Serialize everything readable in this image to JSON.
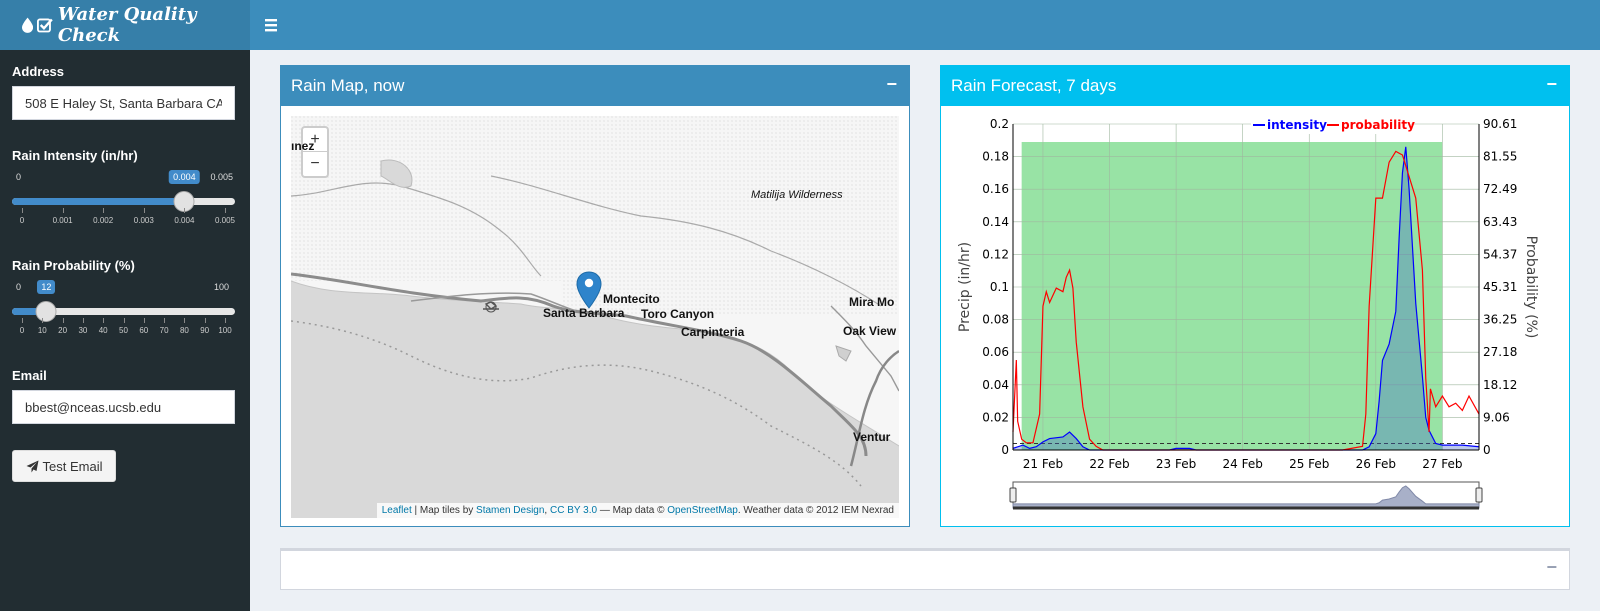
{
  "app": {
    "title": "Water Quality Check"
  },
  "sidebar": {
    "address_label": "Address",
    "address_value": "508 E Haley St, Santa Barbara CA",
    "intensity_label": "Rain Intensity (in/hr)",
    "intensity_slider": {
      "min": "0",
      "max": "0.005",
      "value": "0.004",
      "fraction": 0.8,
      "ticks": [
        "0",
        "0.001",
        "0.002",
        "0.003",
        "0.004",
        "0.005"
      ]
    },
    "probability_label": "Rain Probability (%)",
    "probability_slider": {
      "min": "0",
      "max": "100",
      "value": "12",
      "fraction": 0.12,
      "ticks": [
        "0",
        "10",
        "20",
        "30",
        "40",
        "50",
        "60",
        "70",
        "80",
        "90",
        "100"
      ]
    },
    "email_label": "Email",
    "email_value": "bbest@nceas.ucsb.edu",
    "test_button": "Test Email"
  },
  "map_box": {
    "title": "Rain Map, now",
    "collapse": "−",
    "zoom_in": "+",
    "zoom_out": "−",
    "places": {
      "ynez": "ınez",
      "matilija": "Matilija Wilderness",
      "montecito": "Montecito",
      "santa_barbara": "Santa Barbara",
      "toro_canyon": "Toro Canyon",
      "carpinteria": "Carpinteria",
      "mira_monte": "Mira Mo",
      "oak_view": "Oak View",
      "ventura": "Ventur"
    },
    "attribution": {
      "leaflet": "Leaflet",
      "sep1": " | Map tiles by ",
      "stamen": "Stamen Design",
      "sep2": ", ",
      "cc": "CC BY 3.0",
      "sep3": " — Map data © ",
      "osm": "OpenStreetMap",
      "sep4": ". Weather data © 2012 IEM Nexrad"
    }
  },
  "forecast_box": {
    "title": "Rain Forecast, 7 days",
    "collapse": "−"
  },
  "bottom_box": {
    "collapse": "−"
  },
  "colors": {
    "header": "#3c8dbc",
    "sidebar": "#222d32",
    "forecast_accent": "#00c0ef",
    "intensity": "#0000ff",
    "probability": "#ff0000"
  },
  "chart_data": {
    "type": "line",
    "ylabel": "Precip (in/hr)",
    "y2label": "Probability (%)",
    "ylim": [
      0,
      0.2
    ],
    "y2lim": [
      0,
      90.61
    ],
    "yticks": [
      "0",
      "0.02",
      "0.04",
      "0.06",
      "0.08",
      "0.1",
      "0.12",
      "0.14",
      "0.16",
      "0.18",
      "0.2"
    ],
    "y2ticks": [
      "0",
      "9.06",
      "18.12",
      "27.18",
      "36.25",
      "45.31",
      "54.37",
      "63.43",
      "72.49",
      "81.55",
      "90.61"
    ],
    "xticks": [
      "21 Feb",
      "22 Feb",
      "23 Feb",
      "24 Feb",
      "25 Feb",
      "26 Feb",
      "27 Feb"
    ],
    "xlim": [
      20.55,
      27.55
    ],
    "shaded_range": [
      20.68,
      27.0
    ],
    "threshold": 0.004,
    "legend": {
      "intensity": "intensity",
      "probability": "probability",
      "placement": "top"
    },
    "series": [
      {
        "name": "intensity",
        "x": [
          20.55,
          20.7,
          20.8,
          20.9,
          21.0,
          21.1,
          21.3,
          21.4,
          21.5,
          21.6,
          21.7,
          22.5,
          22.9,
          23.0,
          23.2,
          23.3,
          25.5,
          25.8,
          25.9,
          26.0,
          26.05,
          26.1,
          26.2,
          26.3,
          26.35,
          26.4,
          26.45,
          26.5,
          26.6,
          26.7,
          26.75,
          26.8,
          26.9,
          27.0,
          27.1,
          27.3,
          27.55
        ],
        "values": [
          0.001,
          0.003,
          0.001,
          0.002,
          0.005,
          0.007,
          0.008,
          0.011,
          0.007,
          0.002,
          0,
          0,
          0,
          0.001,
          0.001,
          0,
          0,
          0,
          0.002,
          0.01,
          0.03,
          0.055,
          0.065,
          0.085,
          0.13,
          0.17,
          0.186,
          0.16,
          0.09,
          0.045,
          0.02,
          0.012,
          0.004,
          0.003,
          0.003,
          0.003,
          0.002
        ]
      },
      {
        "name": "probability",
        "x": [
          20.55,
          20.6,
          20.62,
          20.68,
          20.75,
          20.85,
          20.95,
          21.0,
          21.05,
          21.1,
          21.2,
          21.3,
          21.35,
          21.4,
          21.45,
          21.5,
          21.6,
          21.7,
          21.8,
          21.9,
          23.0,
          25.5,
          25.8,
          25.85,
          25.9,
          26.0,
          26.1,
          26.2,
          26.3,
          26.4,
          26.5,
          26.6,
          26.7,
          26.75,
          26.8,
          26.82,
          26.9,
          27.0,
          27.1,
          27.2,
          27.3,
          27.4,
          27.55
        ],
        "values": [
          5,
          25,
          8,
          3,
          2,
          2,
          10,
          40,
          44,
          41,
          45,
          44,
          48,
          50,
          45,
          30,
          12,
          3,
          1,
          0,
          0,
          0,
          1,
          10,
          40,
          70,
          70,
          80,
          83,
          82,
          76,
          70,
          50,
          20,
          5,
          17,
          12,
          15,
          12,
          13,
          11,
          15,
          10
        ]
      }
    ]
  }
}
